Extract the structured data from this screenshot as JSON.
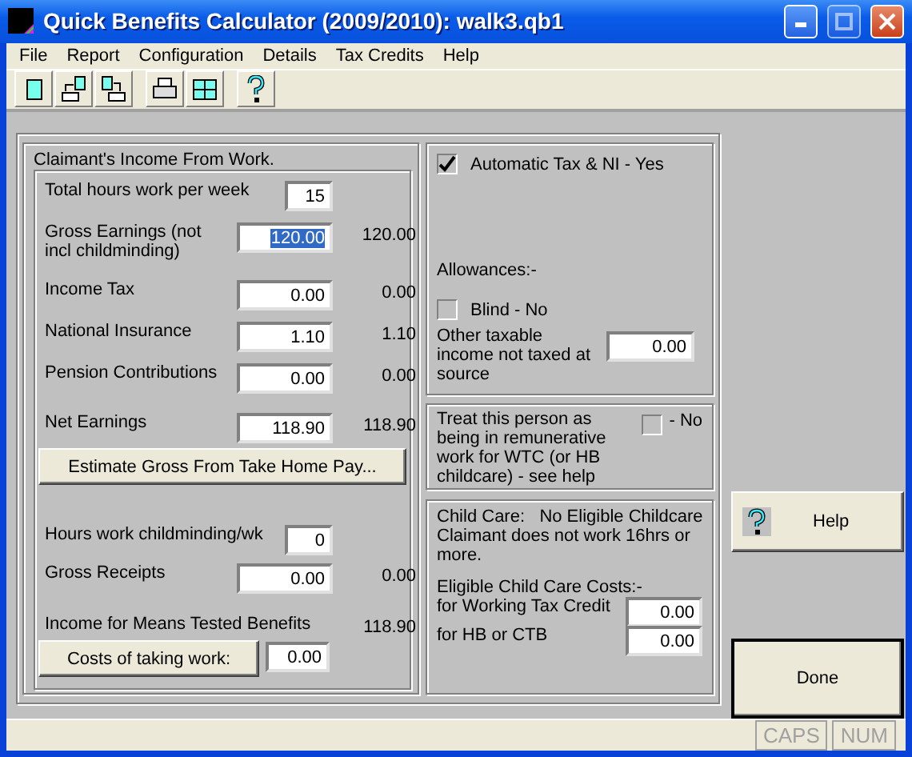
{
  "window": {
    "title": "Quick Benefits Calculator (2009/2010): walk3.qb1"
  },
  "menu": [
    "File",
    "Report",
    "Configuration",
    "Details",
    "Tax Credits",
    "Help"
  ],
  "income": {
    "title": "Claimant's Income From Work.",
    "items": [
      {
        "kind": "small",
        "label": "Total hours work per week",
        "value": "15"
      },
      {
        "kind": "money",
        "label": "Gross Earnings (not incl childminding)",
        "value": "120.00",
        "selected": true,
        "reading": "120.00",
        "rule": false
      },
      {
        "kind": "money",
        "label": "Income Tax",
        "value": "0.00",
        "selected": false,
        "reading": "0.00",
        "rule": false
      },
      {
        "kind": "money",
        "label": "National Insurance",
        "value": "1.10",
        "selected": false,
        "reading": "1.10",
        "rule": false
      },
      {
        "kind": "money",
        "label": "Pension Contributions",
        "value": "0.00",
        "selected": false,
        "reading": "0.00",
        "rule": true
      },
      {
        "kind": "money",
        "label": "Net Earnings",
        "value": "118.90",
        "selected": false,
        "reading": "118.90",
        "rule": false
      },
      {
        "kind": "button",
        "label": "Estimate Gross From Take Home Pay..."
      },
      {
        "kind": "small",
        "label": "Hours work childminding/wk",
        "value": "0"
      },
      {
        "kind": "money",
        "label": "Gross Receipts",
        "value": "0.00",
        "selected": false,
        "reading": "0.00",
        "rule": true
      },
      {
        "kind": "total",
        "label": "Income for Means Tested Benefits",
        "reading": "118.90"
      },
      {
        "kind": "costs",
        "label": "Costs of taking work:",
        "value": "0.00"
      }
    ]
  },
  "tax": {
    "auto": {
      "label": "Automatic Tax & NI  - Yes",
      "checked": true
    },
    "allowances_label": "Allowances:-",
    "blind": {
      "label": "Blind - No",
      "checked": false
    },
    "other_income": {
      "label": "Other taxable income not taxed at source",
      "value": "0.00"
    }
  },
  "remunerative": {
    "label": "Treat this person as being in remunerative work for WTC (or HB childcare) - see help",
    "checked": false,
    "status": "- No"
  },
  "childcare": {
    "status": "Child Care:   No Eligible Childcare",
    "note": "Claimant does not work 16hrs or more.",
    "costs_heading": "Eligible Child Care Costs:-",
    "rows": [
      {
        "label": "for Working Tax Credit",
        "value": "0.00"
      },
      {
        "label": "for HB or CTB",
        "value": "0.00"
      }
    ]
  },
  "help_button": "Help",
  "done_button": "Done",
  "status_bar": [
    {
      "label": "CAPS",
      "disabled": true
    },
    {
      "label": "NUM",
      "disabled": true
    }
  ]
}
